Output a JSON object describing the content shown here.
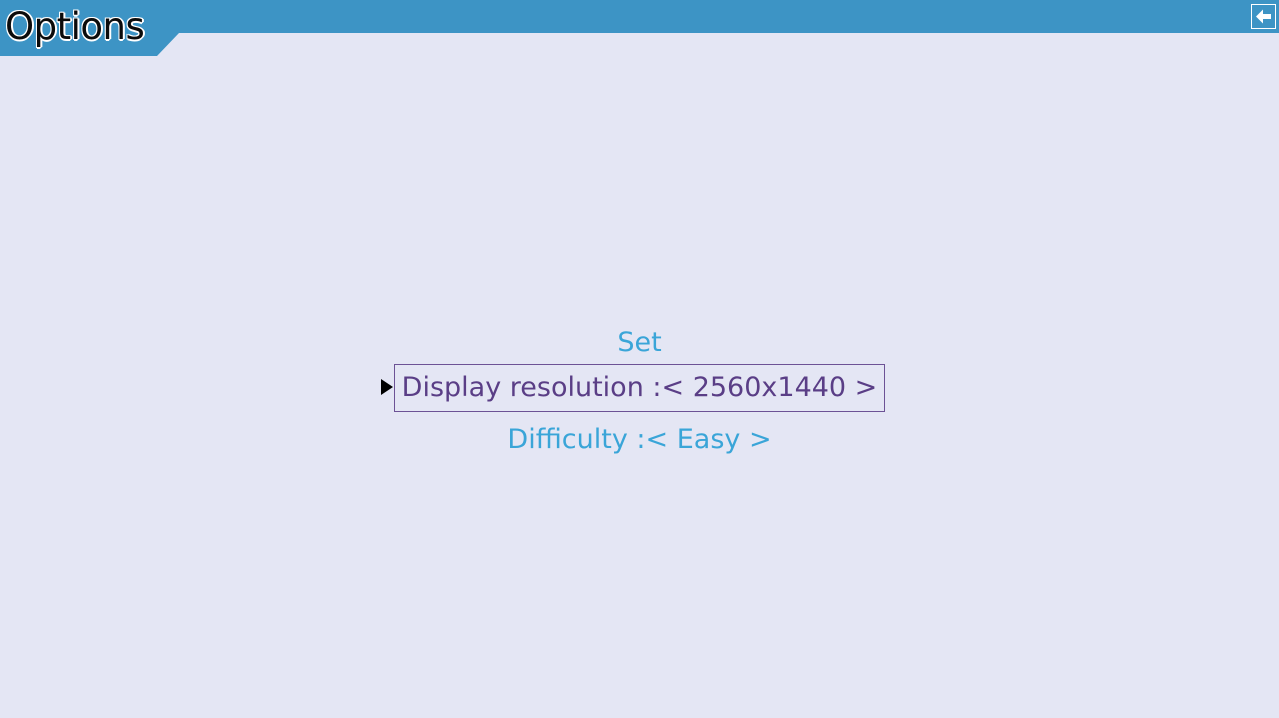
{
  "header": {
    "title": "Options",
    "back_icon": "back-arrow-icon",
    "accent_color": "#3d94c5"
  },
  "menu": {
    "items": [
      {
        "label": "Set",
        "selected": false
      },
      {
        "label": "Display resolution :< 2560x1440 >",
        "selected": true
      },
      {
        "label": "Difficulty :< Easy >",
        "selected": false
      }
    ],
    "item_color": "#3aa5d8",
    "selected_color": "#5a3e86",
    "selector_icon": "pointer-triangle-icon"
  }
}
